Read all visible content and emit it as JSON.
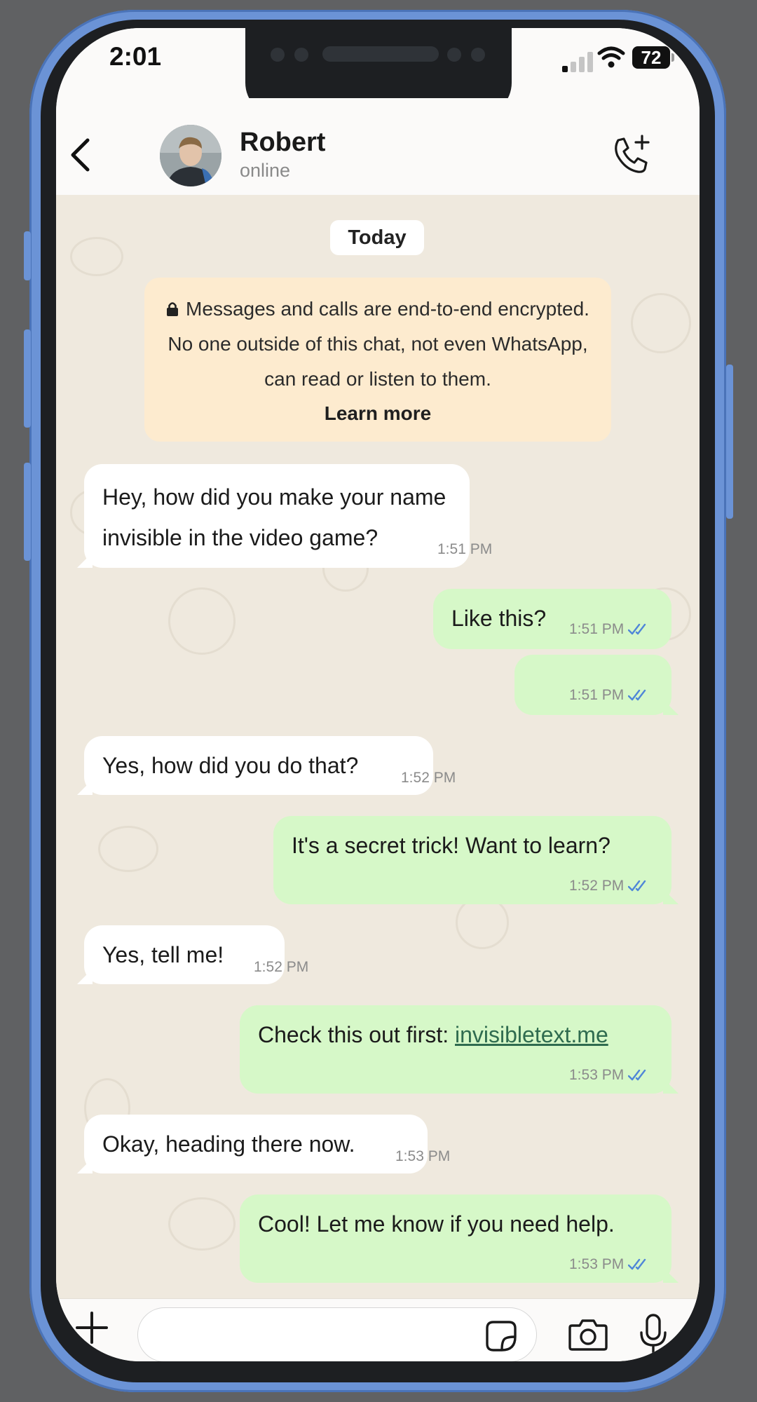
{
  "status_bar": {
    "time": "2:01",
    "battery": "72"
  },
  "header": {
    "back_icon": "chevron-left-icon",
    "contact_name": "Robert",
    "contact_status": "online",
    "call_icon": "add-call-icon"
  },
  "chat": {
    "day_label": "Today",
    "encryption_notice": {
      "text": "Messages and calls are end-to-end encrypted. No one outside of this chat, not even WhatsApp, can read or listen to them.",
      "link_label": "Learn more"
    },
    "messages": [
      {
        "direction": "in",
        "text": "Hey, how did you make your name invisible in the video game?",
        "time": "1:51 PM"
      },
      {
        "direction": "out",
        "text": "Like this?",
        "time": "1:51 PM"
      },
      {
        "direction": "out",
        "text": "",
        "time": "1:51 PM"
      },
      {
        "direction": "in",
        "text": "Yes, how did you do that?",
        "time": "1:52 PM"
      },
      {
        "direction": "out",
        "text": "It's a secret trick! Want to learn?",
        "time": "1:52 PM"
      },
      {
        "direction": "in",
        "text": "Yes, tell me!",
        "time": "1:52 PM"
      },
      {
        "direction": "out",
        "text": "Check this out first: ",
        "link": "invisibletext.me",
        "time": "1:53 PM"
      },
      {
        "direction": "in",
        "text": "Okay, heading there now.",
        "time": "1:53 PM"
      },
      {
        "direction": "out",
        "text": "Cool! Let me know if you need help.",
        "time": "1:53 PM"
      }
    ]
  },
  "composer": {
    "placeholder": "",
    "plus_icon": "plus-icon",
    "sticker_icon": "sticker-icon",
    "camera_icon": "camera-icon",
    "mic_icon": "microphone-icon"
  },
  "colors": {
    "incoming_bubble": "#ffffff",
    "outgoing_bubble": "#d6f8c8",
    "notice_bg": "#fdebcf",
    "chat_bg": "#efe9de",
    "read_ticks": "#4f86d8",
    "frame": "#6b93d6"
  }
}
